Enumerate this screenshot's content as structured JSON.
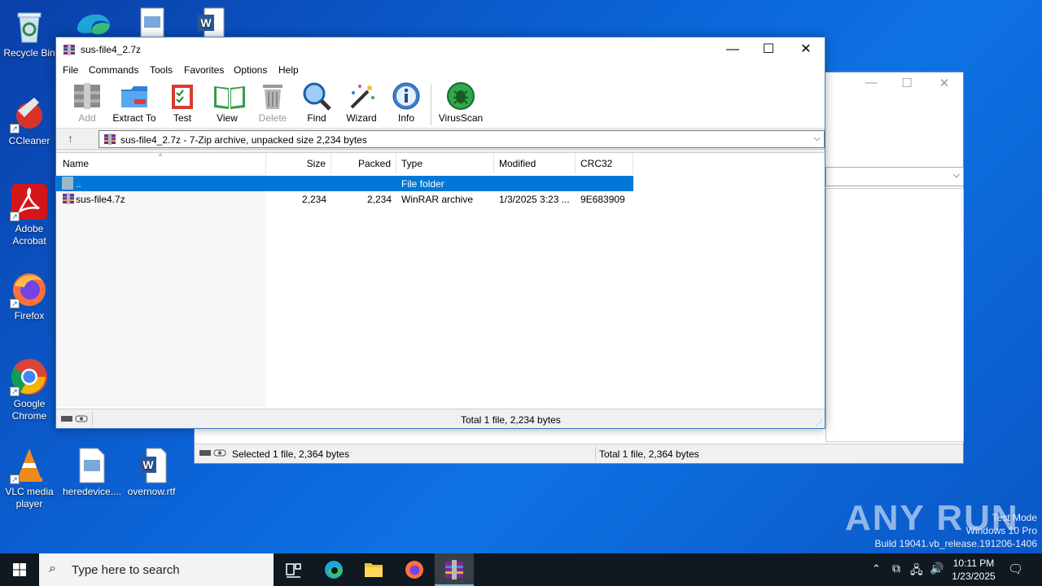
{
  "desktop": {
    "icons": [
      {
        "label": "Recycle Bin",
        "icon": "recycle-bin-icon"
      },
      {
        "label": "CCleaner",
        "icon": "ccleaner-icon"
      },
      {
        "label": "Adobe Acrobat",
        "icon": "acrobat-icon"
      },
      {
        "label": "Firefox",
        "icon": "firefox-icon"
      },
      {
        "label": "Google Chrome",
        "icon": "chrome-icon"
      },
      {
        "label": "VLC media player",
        "icon": "vlc-icon"
      },
      {
        "label": "heredevice....",
        "icon": "image-file-icon"
      },
      {
        "label": "overnow.rtf",
        "icon": "word-doc-icon"
      }
    ]
  },
  "back_window": {
    "status_left": "Selected 1 file, 2,364 bytes",
    "status_right": "Total 1 file, 2,364 bytes"
  },
  "window": {
    "title": "sus-file4_2.7z",
    "menu": [
      "File",
      "Commands",
      "Tools",
      "Favorites",
      "Options",
      "Help"
    ],
    "toolbar": [
      {
        "label": "Add",
        "icon": "add-archive-icon",
        "disabled": true
      },
      {
        "label": "Extract To",
        "icon": "extract-folder-icon",
        "disabled": false
      },
      {
        "label": "Test",
        "icon": "test-clipboard-icon",
        "disabled": false
      },
      {
        "label": "View",
        "icon": "view-book-icon",
        "disabled": false
      },
      {
        "label": "Delete",
        "icon": "delete-bin-icon",
        "disabled": true
      },
      {
        "label": "Find",
        "icon": "find-magnifier-icon",
        "disabled": false
      },
      {
        "label": "Wizard",
        "icon": "wizard-wand-icon",
        "disabled": false
      },
      {
        "label": "Info",
        "icon": "info-icon",
        "disabled": false
      },
      {
        "label": "VirusScan",
        "icon": "virusscan-icon",
        "disabled": false
      }
    ],
    "address": "sus-file4_2.7z - 7-Zip archive, unpacked size 2,234 bytes",
    "columns": {
      "name": "Name",
      "size": "Size",
      "packed": "Packed",
      "type": "Type",
      "modified": "Modified",
      "crc": "CRC32"
    },
    "rows": [
      {
        "name": "..",
        "size": "",
        "packed": "",
        "type": "File folder",
        "modified": "",
        "crc": ""
      },
      {
        "name": "sus-file4.7z",
        "size": "2,234",
        "packed": "2,234",
        "type": "WinRAR archive",
        "modified": "1/3/2025 3:23 ...",
        "crc": "9E683909"
      }
    ],
    "status_total": "Total 1 file, 2,234 bytes"
  },
  "watermark": {
    "logo": "ANY RUN",
    "line1": "Test Mode",
    "line2": "Windows 10 Pro",
    "line3": "Build 19041.vb_release.191206-1406"
  },
  "taskbar": {
    "search_placeholder": "Type here to search",
    "time": "10:11 PM",
    "date": "1/23/2025"
  }
}
